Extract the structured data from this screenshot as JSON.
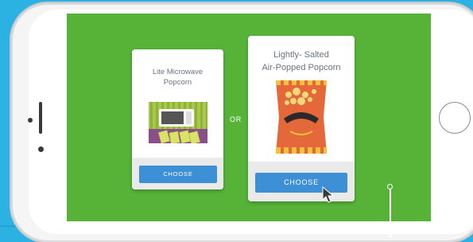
{
  "screen": {
    "choice_separator": "OR",
    "options": [
      {
        "title_line1": "Lite Microwave",
        "title_line2": "Popcorn",
        "button_label": "CHOOSE",
        "image": "microwave-popcorn-box"
      },
      {
        "title_line1": "Lightly- Salted",
        "title_line2": "Air-Popped Popcorn",
        "button_label": "CHOOSE",
        "image": "popcorn-bag"
      }
    ]
  },
  "colors": {
    "page_background": "#2bb2e3",
    "screen_background": "#56b338",
    "button": "#3d8fd6",
    "card_title": "#6a7380"
  },
  "icons": [
    "microwave-icon",
    "popcorn-bag-icon",
    "mouse-cursor-icon",
    "home-button-icon"
  ]
}
